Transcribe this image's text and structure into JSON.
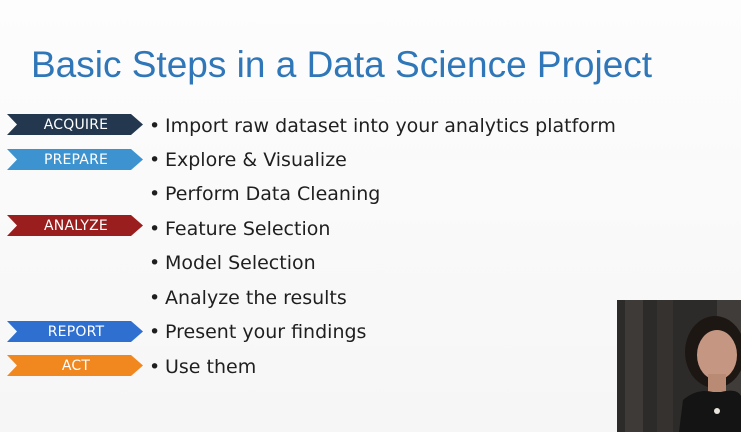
{
  "slide": {
    "title": "Basic Steps in a Data Science Project"
  },
  "tags": {
    "acquire": {
      "label": "ACQUIRE",
      "color": "#23384f"
    },
    "prepare": {
      "label": "PREPARE",
      "color": "#3c93cf"
    },
    "analyze": {
      "label": "ANALYZE",
      "color": "#9a1e1e"
    },
    "report": {
      "label": "REPORT",
      "color": "#2f6fd0"
    },
    "act": {
      "label": "ACT",
      "color": "#f0871f"
    }
  },
  "bullets": [
    {
      "bullet": "•",
      "text": "Import raw dataset into your analytics platform"
    },
    {
      "bullet": "•",
      "text": "Explore & Visualize"
    },
    {
      "bullet": "•",
      "text": "Perform Data Cleaning"
    },
    {
      "bullet": "•",
      "text": "Feature Selection"
    },
    {
      "bullet": "•",
      "text": "Model Selection"
    },
    {
      "bullet": "•",
      "text": "Analyze the results"
    },
    {
      "bullet": "•",
      "text": "Present your findings"
    },
    {
      "bullet": "•",
      "text": "Use them"
    }
  ]
}
